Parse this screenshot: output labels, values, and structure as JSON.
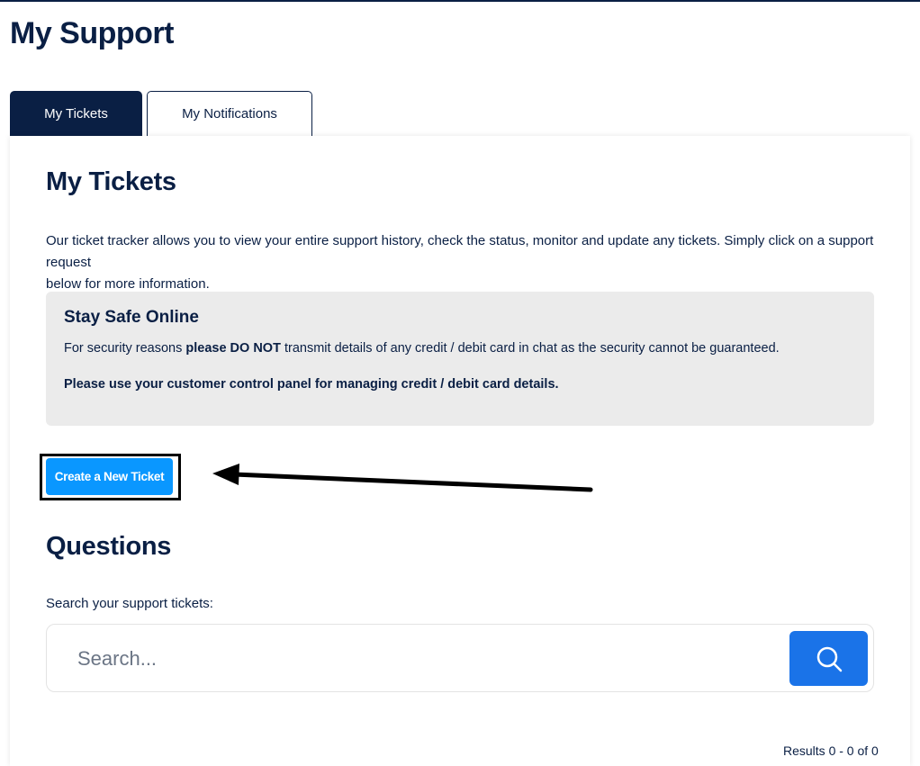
{
  "page": {
    "title": "My Support"
  },
  "tabs": [
    {
      "label": "My Tickets",
      "active": true
    },
    {
      "label": "My Notifications",
      "active": false
    }
  ],
  "tickets": {
    "heading": "My Tickets",
    "intro_line1": "Our ticket tracker allows you to view your entire support history, check the status, monitor and update any tickets. Simply click on a support request",
    "intro_line2": "below for more information."
  },
  "notice": {
    "title": "Stay Safe Online",
    "line1_prefix": "For security reasons ",
    "line1_bold": "please DO NOT",
    "line1_suffix": " transmit details of any credit / debit card in chat as the security cannot be guaranteed.",
    "line2": "Please use your customer control panel for managing credit / debit card details."
  },
  "create_button": {
    "label": "Create a New Ticket"
  },
  "questions": {
    "heading": "Questions",
    "search_label": "Search your support tickets:",
    "search_placeholder": "Search...",
    "search_icon": "search-icon"
  },
  "results": {
    "text": "Results 0 - 0 of 0"
  },
  "colors": {
    "navy": "#0a1f44",
    "create_button": "#0a97ff",
    "search_button": "#1a73e8",
    "notice_bg": "#ebebeb"
  }
}
